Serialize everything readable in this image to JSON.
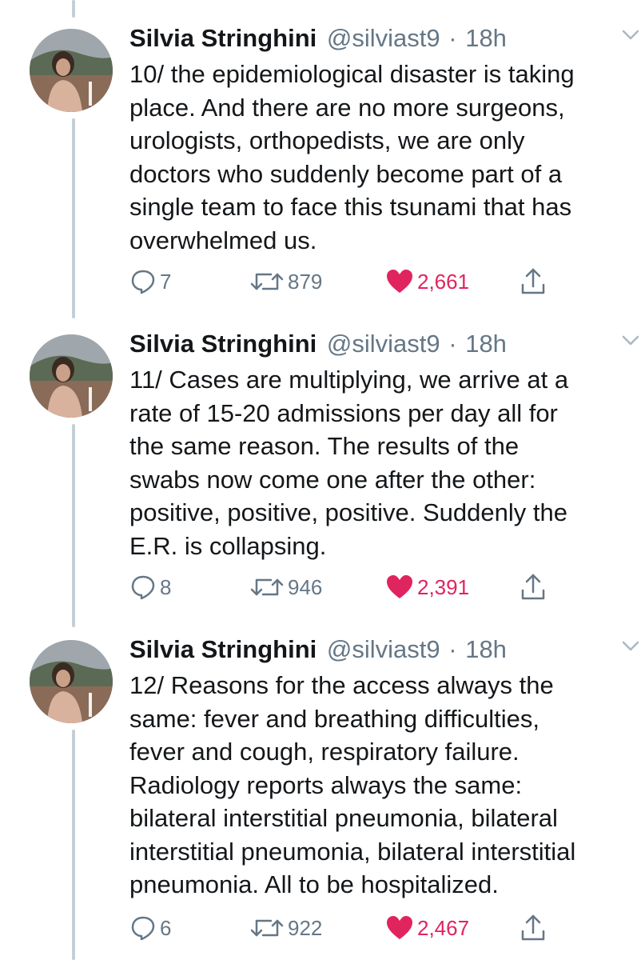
{
  "tweets": [
    {
      "name": "Silvia Stringhini",
      "handle": "@silviast9",
      "separator": "·",
      "time": "18h",
      "text": "10/ the epidemiological disaster is taking\nplace. And there are no more surgeons,\nurologists, orthopedists, we are only\ndoctors who suddenly become part of a\nsingle team to face this tsunami that has\noverwhelmed us.",
      "replies": "7",
      "retweets": "879",
      "likes": "2,661"
    },
    {
      "name": "Silvia Stringhini",
      "handle": "@silviast9",
      "separator": "·",
      "time": "18h",
      "text": "11/ Cases are multiplying, we arrive at a\nrate of 15-20 admissions per day all for\nthe same reason. The results of the\nswabs now come one after the other:\npositive, positive, positive. Suddenly the\nE.R. is collapsing.",
      "replies": "8",
      "retweets": "946",
      "likes": "2,391"
    },
    {
      "name": "Silvia Stringhini",
      "handle": "@silviast9",
      "separator": "·",
      "time": "18h",
      "text": "12/ Reasons for the access always the\nsame: fever and breathing difficulties,\nfever and cough, respiratory failure.\nRadiology reports always the same:\nbilateral interstitial pneumonia, bilateral\ninterstitial pneumonia, bilateral interstitial\npneumonia. All to be hospitalized.",
      "replies": "6",
      "retweets": "922",
      "likes": "2,467"
    }
  ],
  "colors": {
    "text": "#14171a",
    "secondary": "#657786",
    "like": "#e0245e",
    "thread_line": "#c4cfd6"
  },
  "icons": [
    "reply-icon",
    "retweet-icon",
    "like-icon",
    "share-icon",
    "chevron-down-icon"
  ]
}
